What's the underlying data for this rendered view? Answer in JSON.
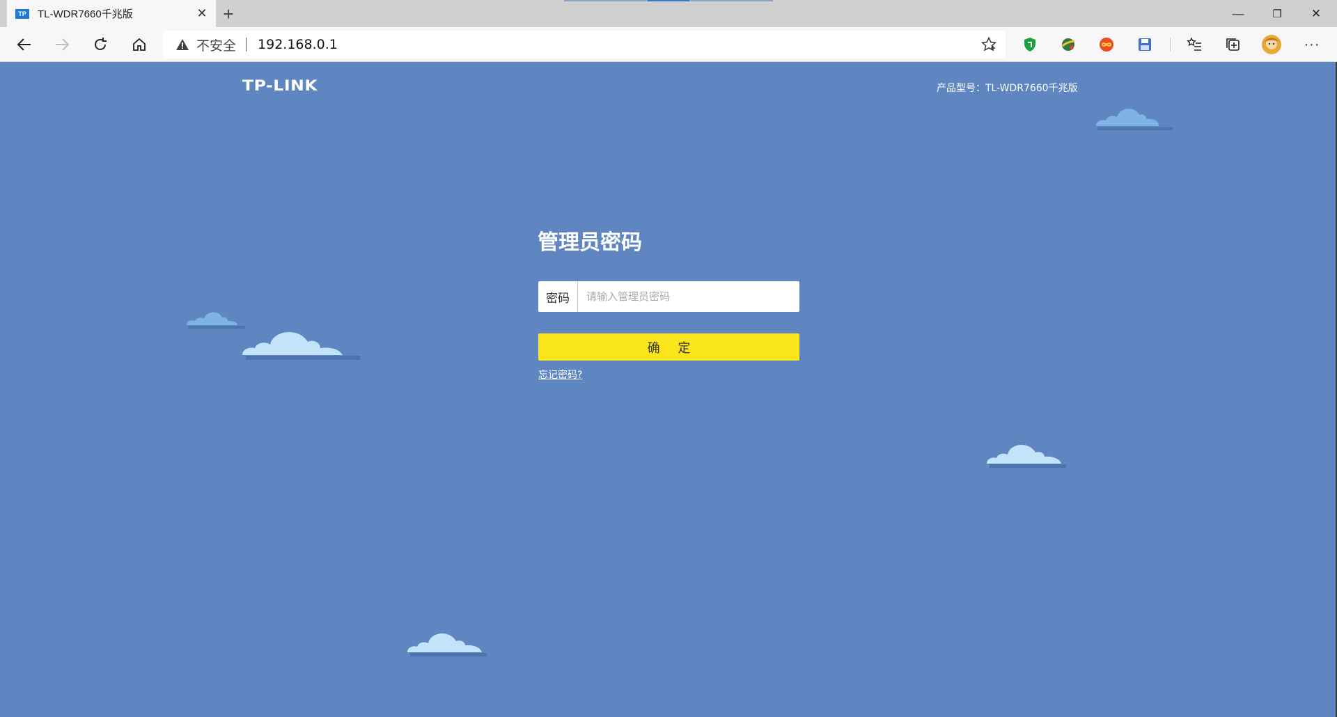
{
  "browser": {
    "tab": {
      "favicon_text": "TP",
      "title": "TL-WDR7660千兆版",
      "close_glyph": "✕"
    },
    "new_tab_glyph": "+",
    "window_controls": {
      "minimize_glyph": "—",
      "restore_glyph": "❐",
      "close_glyph": "✕"
    },
    "address_bar": {
      "security_label": "不安全",
      "url": "192.168.0.1"
    },
    "icons": [
      "back-arrow-icon",
      "forward-arrow-icon",
      "refresh-icon",
      "home-icon",
      "warning-icon",
      "favorite-star-icon",
      "shield-extension-icon",
      "globe-extension-icon",
      "infinity-extension-icon",
      "save-extension-icon",
      "favorites-list-icon",
      "collections-icon",
      "profile-avatar-icon",
      "more-menu-icon"
    ],
    "colors": {
      "tabstrip": "#cfcfcf",
      "toolbar": "#f7f7f7"
    }
  },
  "page": {
    "logo": "TP-LINK",
    "model": "产品型号：TL-WDR7660千兆版",
    "login": {
      "title": "管理员密码",
      "password_label": "密码",
      "password_placeholder": "请输入管理员密码",
      "password_value": "",
      "confirm_label": "确 定",
      "forgot_link": "忘记密码?"
    },
    "colors": {
      "background": "#5f86c1",
      "confirm_button": "#fae41c",
      "cloud_light": "#c3e3fb",
      "cloud_mid": "#7fb3e6",
      "cloud_shadow": "#4d73ad"
    }
  }
}
